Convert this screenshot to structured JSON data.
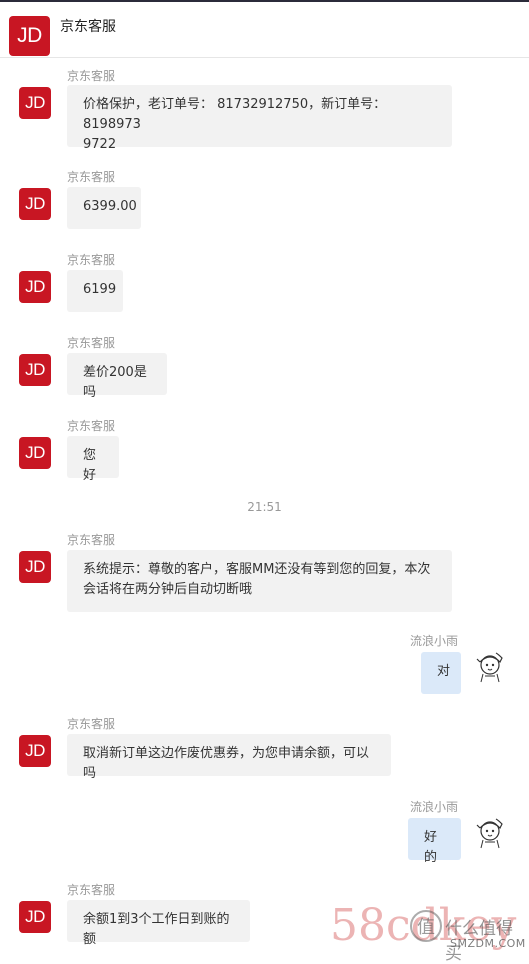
{
  "header": {
    "title": "京东客服",
    "logo_text": "JD"
  },
  "agent_name": "京东客服",
  "user_name": "流浪小雨",
  "timestamp": "21:51",
  "messages": {
    "m1": {
      "line1": "价格保护，老订单号： 81732912750，新订单号： 8198973",
      "line2": "9722"
    },
    "m2": "6399.00",
    "m3": "6199",
    "m4": "差价200是吗",
    "m5": "您好",
    "m6": {
      "line1": "系统提示：尊敬的客户，客服MM还没有等到您的回复，本次",
      "line2": "会话将在两分钟后自动切断哦"
    },
    "u1": "对",
    "m7": "取消新订单这边作废优惠券，为您申请余额，可以吗",
    "u2": "好的",
    "m8": "余额1到3个工作日到账的额"
  },
  "watermark": {
    "site": "58cdkey",
    "brand": "什么值得买",
    "url": "SMZDM.COM",
    "badge": "值"
  },
  "colors": {
    "brand": "#c81623",
    "agent_bubble": "#f2f2f2",
    "user_bubble": "#dbe9f9"
  }
}
